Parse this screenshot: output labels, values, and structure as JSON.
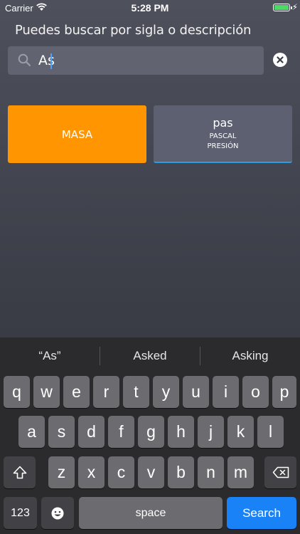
{
  "status_bar": {
    "carrier": "Carrier",
    "time": "5:28 PM"
  },
  "search": {
    "prompt": "Puedes buscar por sigla o descripción",
    "value": "As",
    "clear_icon": "clear-circle-icon"
  },
  "results": [
    {
      "symbol": "MASA",
      "lines": []
    },
    {
      "symbol": "pas",
      "lines": [
        "PASCAL",
        "PRESIÓN"
      ]
    }
  ],
  "keyboard": {
    "suggestions": [
      "“As”",
      "Asked",
      "Asking"
    ],
    "row1": [
      "q",
      "w",
      "e",
      "r",
      "t",
      "y",
      "u",
      "i",
      "o",
      "p"
    ],
    "row2": [
      "a",
      "s",
      "d",
      "f",
      "g",
      "h",
      "j",
      "k",
      "l"
    ],
    "row3": [
      "z",
      "x",
      "c",
      "v",
      "b",
      "n",
      "m"
    ],
    "numbers_label": "123",
    "space_label": "space",
    "search_label": "Search"
  },
  "colors": {
    "accent_orange": "#ff9500",
    "accent_blue": "#1a82f7",
    "battery_green": "#4cd964"
  }
}
